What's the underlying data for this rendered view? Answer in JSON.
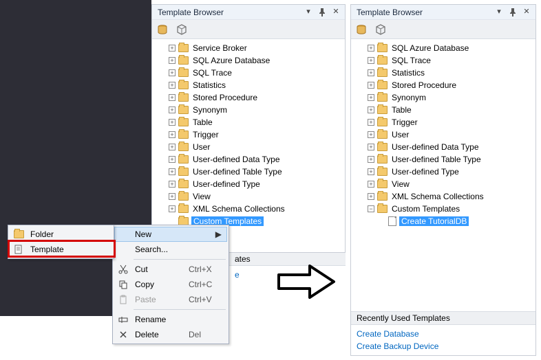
{
  "window_title": "Template Browser",
  "left_tree": [
    {
      "label": "Service Broker",
      "exp": "plus",
      "icon": "folder"
    },
    {
      "label": "SQL Azure Database",
      "exp": "plus",
      "icon": "folder"
    },
    {
      "label": "SQL Trace",
      "exp": "plus",
      "icon": "folder"
    },
    {
      "label": "Statistics",
      "exp": "plus",
      "icon": "folder"
    },
    {
      "label": "Stored Procedure",
      "exp": "plus",
      "icon": "folder"
    },
    {
      "label": "Synonym",
      "exp": "plus",
      "icon": "folder"
    },
    {
      "label": "Table",
      "exp": "plus",
      "icon": "folder"
    },
    {
      "label": "Trigger",
      "exp": "plus",
      "icon": "folder"
    },
    {
      "label": "User",
      "exp": "plus",
      "icon": "folder"
    },
    {
      "label": "User-defined Data Type",
      "exp": "plus",
      "icon": "folder"
    },
    {
      "label": "User-defined Table Type",
      "exp": "plus",
      "icon": "folder"
    },
    {
      "label": "User-defined Type",
      "exp": "plus",
      "icon": "folder"
    },
    {
      "label": "View",
      "exp": "plus",
      "icon": "folder"
    },
    {
      "label": "XML Schema Collections",
      "exp": "plus",
      "icon": "folder"
    },
    {
      "label": "Custom Templates",
      "exp": "none",
      "icon": "folder",
      "selected": true
    }
  ],
  "right_tree": [
    {
      "label": "SQL Azure Database",
      "exp": "plus",
      "icon": "folder"
    },
    {
      "label": "SQL Trace",
      "exp": "plus",
      "icon": "folder"
    },
    {
      "label": "Statistics",
      "exp": "plus",
      "icon": "folder"
    },
    {
      "label": "Stored Procedure",
      "exp": "plus",
      "icon": "folder"
    },
    {
      "label": "Synonym",
      "exp": "plus",
      "icon": "folder"
    },
    {
      "label": "Table",
      "exp": "plus",
      "icon": "folder"
    },
    {
      "label": "Trigger",
      "exp": "plus",
      "icon": "folder"
    },
    {
      "label": "User",
      "exp": "plus",
      "icon": "folder"
    },
    {
      "label": "User-defined Data Type",
      "exp": "plus",
      "icon": "folder"
    },
    {
      "label": "User-defined Table Type",
      "exp": "plus",
      "icon": "folder"
    },
    {
      "label": "User-defined Type",
      "exp": "plus",
      "icon": "folder"
    },
    {
      "label": "View",
      "exp": "plus",
      "icon": "folder"
    },
    {
      "label": "XML Schema Collections",
      "exp": "plus",
      "icon": "folder"
    },
    {
      "label": "Custom Templates",
      "exp": "minus",
      "icon": "folder"
    },
    {
      "label": "Create TutorialDB",
      "exp": "none",
      "icon": "file",
      "depth": 2,
      "selected": true
    }
  ],
  "recent_header": "Recently Used Templates",
  "recent_items": [
    "Create Database",
    "Create Backup Device"
  ],
  "left_peek": "ates",
  "ctx": {
    "new": "New",
    "search": "Search...",
    "cut": "Cut",
    "cut_sc": "Ctrl+X",
    "copy": "Copy",
    "copy_sc": "Ctrl+C",
    "paste": "Paste",
    "paste_sc": "Ctrl+V",
    "rename": "Rename",
    "delete": "Delete",
    "delete_sc": "Del"
  },
  "sub": {
    "folder": "Folder",
    "template": "Template"
  }
}
